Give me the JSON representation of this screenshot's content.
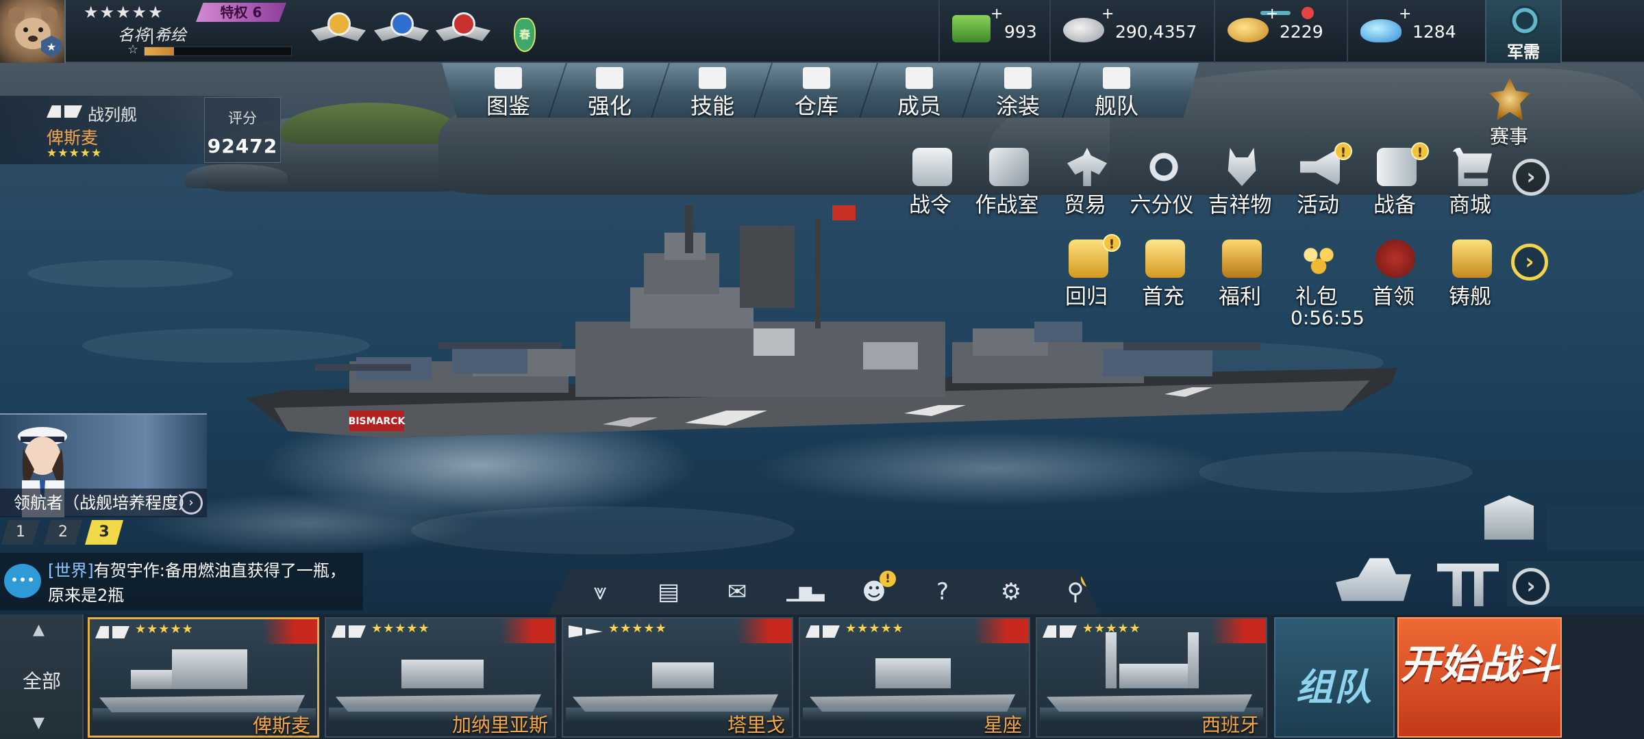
{
  "player": {
    "name": "名将|希绘",
    "stars": "★★★★★",
    "vip_label": "特权 6",
    "exp_star": "☆",
    "exp_fraction": 0.2
  },
  "medals": [
    "gold-wing-medal",
    "blue-wing-medal",
    "red-wing-medal"
  ],
  "spring_badge": "春",
  "resources": [
    {
      "name": "cash-icon",
      "plus": "+",
      "value": "993"
    },
    {
      "name": "silver-coins-icon",
      "plus": "+",
      "value": "290,4357"
    },
    {
      "name": "gold-coins-icon",
      "plus": "+",
      "value": "2229"
    },
    {
      "name": "diamond-icon",
      "plus": "+",
      "value": "1284"
    }
  ],
  "military": {
    "label": "军需"
  },
  "nav_tabs": [
    "图鉴",
    "强化",
    "技能",
    "仓库",
    "成员",
    "涂装",
    "舰队"
  ],
  "ship_info": {
    "class": "战列舰",
    "name": "俾斯麦",
    "stars": "★★★★★",
    "score_label": "评分",
    "score_value": "92472"
  },
  "tournament": {
    "label": "赛事"
  },
  "events_row1": [
    {
      "label": "战令",
      "badge": ""
    },
    {
      "label": "作战室",
      "badge": ""
    },
    {
      "label": "贸易",
      "badge": ""
    },
    {
      "label": "六分仪",
      "badge": ""
    },
    {
      "label": "吉祥物",
      "badge": ""
    },
    {
      "label": "活动",
      "badge": "!"
    },
    {
      "label": "战备",
      "badge": "!"
    },
    {
      "label": "商城",
      "badge": ""
    }
  ],
  "events_row2": [
    {
      "label": "回归",
      "badge": "!"
    },
    {
      "label": "首充",
      "badge": ""
    },
    {
      "label": "福利",
      "badge": ""
    },
    {
      "label": "礼包",
      "badge": ""
    },
    {
      "label": "首领",
      "badge": ""
    },
    {
      "label": "铸舰",
      "badge": ""
    }
  ],
  "gift_timer": "0:56:55",
  "ship_hull_text": "BISMARCK",
  "navigator": {
    "label": "领航者（战舰培养程度）"
  },
  "pages": [
    "1",
    "2",
    "3"
  ],
  "active_page": "3",
  "chat": {
    "tag": "[世界]",
    "message": "有贺宇作:备用燃油直获得了一瓶，原来是2瓶"
  },
  "toolbar": [
    {
      "name": "collapse-icon",
      "glyph": "⩔",
      "badge": ""
    },
    {
      "name": "clipboard-icon",
      "glyph": "▤",
      "badge": ""
    },
    {
      "name": "mail-icon",
      "glyph": "✉",
      "badge": ""
    },
    {
      "name": "ranking-icon",
      "glyph": "▁▆▃",
      "badge": ""
    },
    {
      "name": "friends-icon",
      "glyph": "☻",
      "badge": "!"
    },
    {
      "name": "help-icon",
      "glyph": "?",
      "badge": ""
    },
    {
      "name": "settings-icon",
      "glyph": "⚙",
      "badge": ""
    },
    {
      "name": "tips-icon",
      "glyph": "⚲",
      "badge": "!"
    }
  ],
  "fleet": {
    "all_label": "全部",
    "up": "▲",
    "down": "▼"
  },
  "ships": [
    {
      "name": "俾斯麦",
      "stars": "★★★★★",
      "selected": true
    },
    {
      "name": "加纳里亚斯",
      "stars": "★★★★★",
      "selected": false
    },
    {
      "name": "塔里戈",
      "stars": "★★★★★",
      "selected": false
    },
    {
      "name": "星座",
      "stars": "★★★★★",
      "selected": false
    },
    {
      "name": "西班牙",
      "stars": "★★★★★",
      "selected": false
    }
  ],
  "team_button": "组队",
  "battle_button": "开始战斗",
  "arrow": "›"
}
